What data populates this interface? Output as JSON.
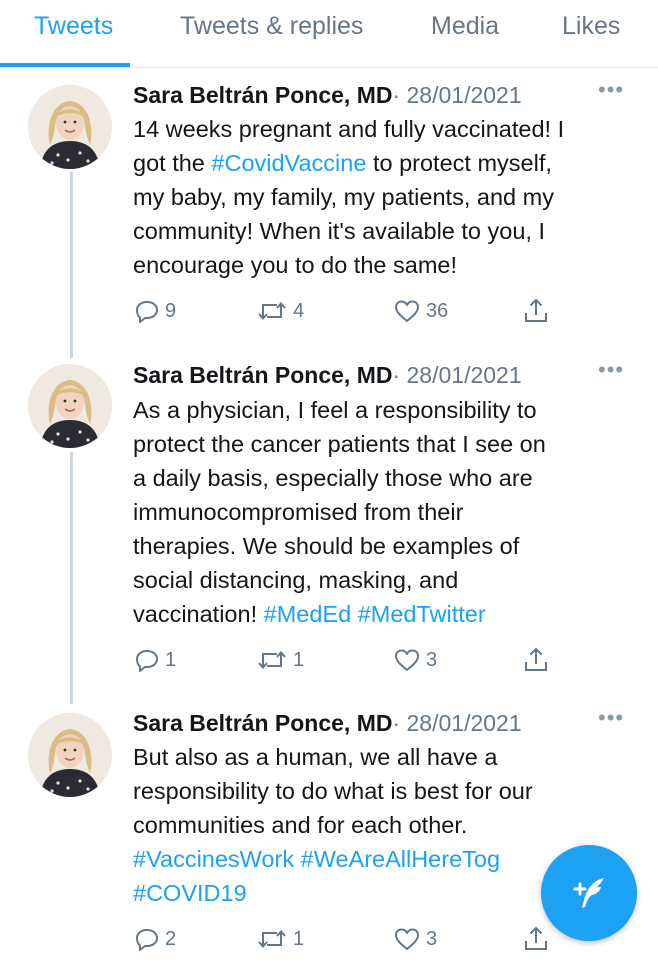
{
  "tabs": [
    {
      "label": "Tweets",
      "active": true
    },
    {
      "label": "Tweets & replies",
      "active": false
    },
    {
      "label": "Media",
      "active": false
    },
    {
      "label": "Likes",
      "active": false
    }
  ],
  "tweets": [
    {
      "author": "Sara Beltrán Ponce, MD",
      "date": "· 28/01/2021",
      "lines": [
        [
          {
            "t": "14 weeks pregnant and fully vaccinated! I"
          }
        ],
        [
          {
            "t": "got the "
          },
          {
            "t": "#CovidVaccine",
            "tag": true
          },
          {
            "t": " to protect myself,"
          }
        ],
        [
          {
            "t": "my baby, my family, my patients, and my"
          }
        ],
        [
          {
            "t": "community! When it's available to you, I"
          }
        ],
        [
          {
            "t": "encourage you to do the same!"
          }
        ]
      ],
      "replies": "9",
      "retweets": "4",
      "likes": "36"
    },
    {
      "author": "Sara Beltrán Ponce, MD",
      "date": "· 28/01/2021",
      "lines": [
        [
          {
            "t": "As a physician, I feel a responsibility to"
          }
        ],
        [
          {
            "t": "protect the cancer patients that I see on"
          }
        ],
        [
          {
            "t": "a daily basis, especially those who are"
          }
        ],
        [
          {
            "t": "immunocompromised from their"
          }
        ],
        [
          {
            "t": "therapies. We should be examples of"
          }
        ],
        [
          {
            "t": "social distancing, masking, and"
          }
        ],
        [
          {
            "t": "vaccination! "
          },
          {
            "t": "#MedEd",
            "tag": true
          },
          {
            "t": " "
          },
          {
            "t": "#MedTwitter",
            "tag": true
          }
        ]
      ],
      "replies": "1",
      "retweets": "1",
      "likes": "3"
    },
    {
      "author": "Sara Beltrán Ponce, MD",
      "date": "· 28/01/2021",
      "lines": [
        [
          {
            "t": "But also as a human, we all have a"
          }
        ],
        [
          {
            "t": "responsibility to do what is best for our"
          }
        ],
        [
          {
            "t": "communities and for each other."
          }
        ],
        [
          {
            "t": "#VaccinesWork",
            "tag": true
          },
          {
            "t": " "
          },
          {
            "t": "#WeAreAllHereTog",
            "tag": true
          }
        ],
        [
          {
            "t": "#COVID19",
            "tag": true
          }
        ]
      ],
      "replies": "2",
      "retweets": "1",
      "likes": "3"
    }
  ],
  "icons": {
    "reply": "reply-icon",
    "retweet": "retweet-icon",
    "like": "heart-icon",
    "share": "share-icon",
    "more": "more-icon",
    "compose": "compose-tweet-icon"
  },
  "more_glyph": "•••",
  "colors": {
    "accent": "#1da1f2",
    "text": "#14171a",
    "secondary": "#657786",
    "thread_line": "#cdd6dd"
  }
}
